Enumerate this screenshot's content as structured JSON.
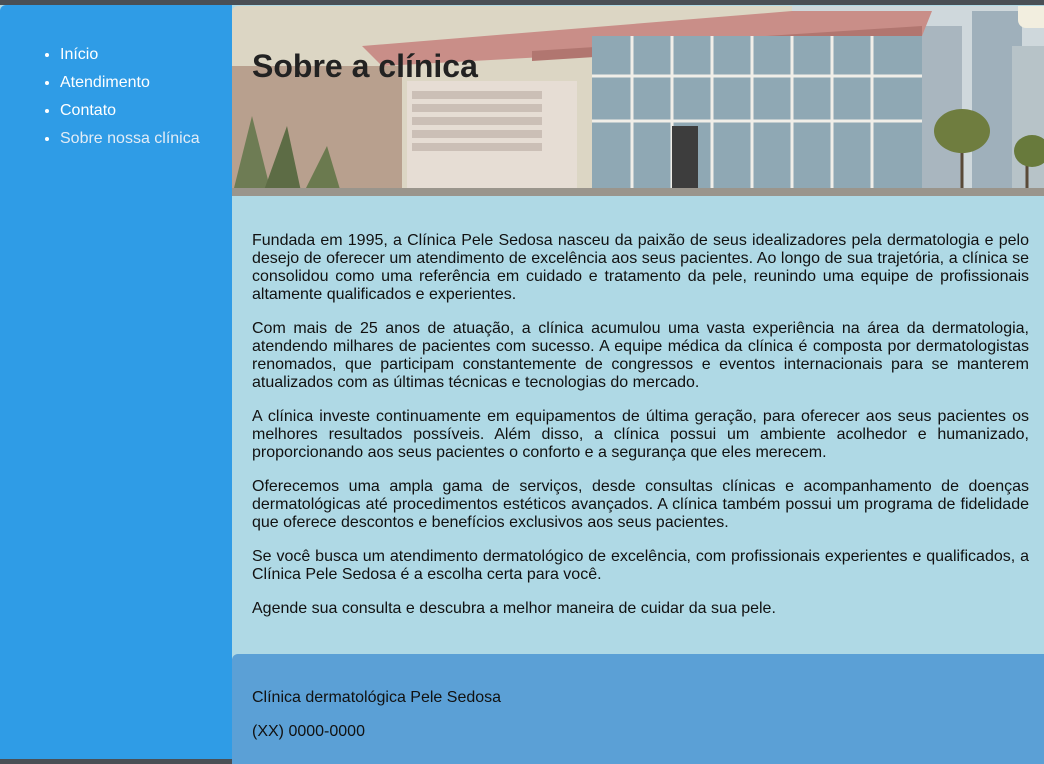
{
  "nav": {
    "items": [
      {
        "label": "Início"
      },
      {
        "label": "Atendimento"
      },
      {
        "label": "Contato"
      },
      {
        "label": "Sobre nossa clínica"
      }
    ]
  },
  "header": {
    "title": "Sobre a clínica"
  },
  "main": {
    "paragraphs": [
      "Fundada em 1995, a Clínica Pele Sedosa nasceu da paixão de seus idealizadores pela dermatologia e pelo desejo de oferecer um atendimento de excelência aos seus pacientes. Ao longo de sua trajetória, a clínica se consolidou como uma referência em cuidado e tratamento da pele, reunindo uma equipe de profissionais altamente qualificados e experientes.",
      "Com mais de 25 anos de atuação, a clínica acumulou uma vasta experiência na área da dermatologia, atendendo milhares de pacientes com sucesso. A equipe médica da clínica é composta por dermatologistas renomados, que participam constantemente de congressos e eventos internacionais para se manterem atualizados com as últimas técnicas e tecnologias do mercado.",
      "A clínica investe continuamente em equipamentos de última geração, para oferecer aos seus pacientes os melhores resultados possíveis. Além disso, a clínica possui um ambiente acolhedor e humanizado, proporcionando aos seus pacientes o conforto e a segurança que eles merecem.",
      "Oferecemos uma ampla gama de serviços, desde consultas clínicas e acompanhamento de doenças dermatológicas até procedimentos estéticos avançados. A clínica também possui um programa de fidelidade que oferece descontos e benefícios exclusivos aos seus pacientes.",
      "Se você busca um atendimento dermatológico de excelência, com profissionais experientes e qualificados, a Clínica Pele Sedosa é a escolha certa para você.",
      "Agende sua consulta e descubra a melhor maneira de cuidar da sua pele."
    ]
  },
  "footer": {
    "name": "Clínica dermatológica Pele Sedosa",
    "phone": "(XX) 0000-0000"
  },
  "colors": {
    "sidebar": "#2f9ce6",
    "content_bg": "#afd9e5",
    "footer_bg": "#5ba0d6",
    "visited_link": "#e2ecf6"
  }
}
